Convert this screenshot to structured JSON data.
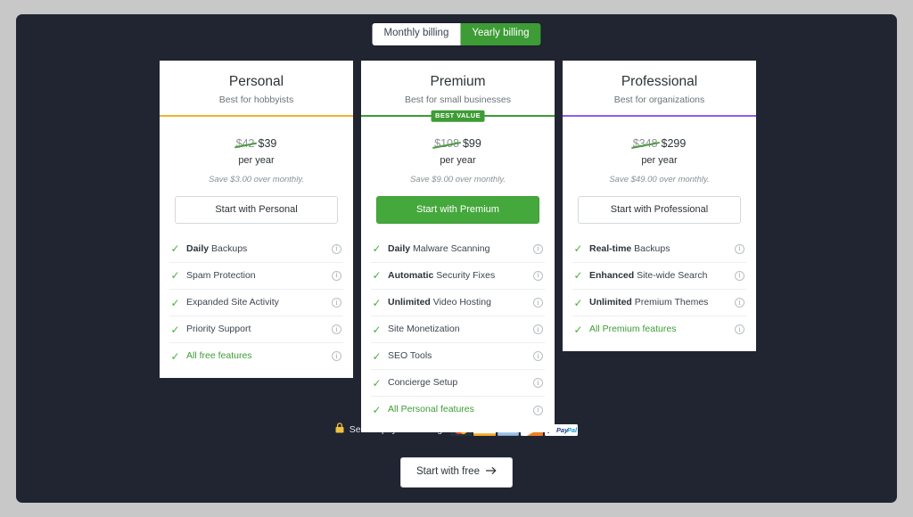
{
  "theme": {
    "page_background": "#c8c8c8",
    "viewport_background": "#212532",
    "card_background": "#ffffff",
    "green_accent": "#3d9c35",
    "amber_accent": "#f0b429",
    "purple_accent": "#8b5cf6"
  },
  "billing_toggle": {
    "monthly_label": "Monthly billing",
    "yearly_label": "Yearly billing",
    "selected": "Yearly billing"
  },
  "plans": [
    {
      "name": "Personal",
      "tagline": "Best for hobbyists",
      "accent_color": "#f0b429",
      "badge": null,
      "price_old": "$42",
      "price_new": "$39",
      "per_unit": "per year",
      "savings": "Save $3.00 over monthly.",
      "cta_label": "Start with Personal",
      "cta_style": "outline",
      "features": [
        {
          "bold": "Daily",
          "text": " Backups",
          "highlight": false,
          "info": "i"
        },
        {
          "bold": "",
          "text": "Spam Protection",
          "highlight": false,
          "info": "i"
        },
        {
          "bold": "",
          "text": "Expanded Site Activity",
          "highlight": false,
          "info": "i"
        },
        {
          "bold": "",
          "text": "Priority Support",
          "highlight": false,
          "info": "i"
        },
        {
          "bold": "",
          "text": "All free features",
          "highlight": true,
          "info": "i"
        }
      ]
    },
    {
      "name": "Premium",
      "tagline": "Best for small businesses",
      "accent_color": "#3d9c35",
      "badge": "BEST VALUE",
      "price_old": "$108",
      "price_new": "$99",
      "per_unit": "per year",
      "savings": "Save $9.00 over monthly.",
      "cta_label": "Start with Premium",
      "cta_style": "filled",
      "features": [
        {
          "bold": "Daily",
          "text": " Malware Scanning",
          "highlight": false,
          "info": "i"
        },
        {
          "bold": "Automatic",
          "text": " Security Fixes",
          "highlight": false,
          "info": "i"
        },
        {
          "bold": "Unlimited",
          "text": " Video Hosting",
          "highlight": false,
          "info": "i"
        },
        {
          "bold": "",
          "text": "Site Monetization",
          "highlight": false,
          "info": "i"
        },
        {
          "bold": "",
          "text": "SEO Tools",
          "highlight": false,
          "info": "i"
        },
        {
          "bold": "",
          "text": "Concierge Setup",
          "highlight": false,
          "info": "i"
        },
        {
          "bold": "",
          "text": "All Personal features",
          "highlight": true,
          "info": "i"
        }
      ]
    },
    {
      "name": "Professional",
      "tagline": "Best for organizations",
      "accent_color": "#8b5cf6",
      "badge": null,
      "price_old": "$348",
      "price_new": "$299",
      "per_unit": "per year",
      "savings": "Save $49.00 over monthly.",
      "cta_label": "Start with Professional",
      "cta_style": "outline",
      "features": [
        {
          "bold": "Real-time",
          "text": " Backups",
          "highlight": false,
          "info": "i"
        },
        {
          "bold": "Enhanced",
          "text": " Site-wide Search",
          "highlight": false,
          "info": "i"
        },
        {
          "bold": "Unlimited",
          "text": " Premium Themes",
          "highlight": false,
          "info": "i"
        },
        {
          "bold": "",
          "text": "All Premium features",
          "highlight": true,
          "info": "i"
        }
      ]
    }
  ],
  "secure_payment": {
    "lock_icon": "lock-icon",
    "label": "Secure payment using:",
    "methods": [
      {
        "name": "mastercard-logo",
        "label": "MasterCard"
      },
      {
        "name": "visa-logo",
        "label": "VISA"
      },
      {
        "name": "amex-logo",
        "label": "AMERICAN EXPRESS"
      },
      {
        "name": "discover-logo",
        "label": "DISCOVER"
      },
      {
        "name": "paypal-logo",
        "label": "PayPal"
      }
    ]
  },
  "free_cta": {
    "label": "Start with free",
    "arrow_icon": "arrow-right-icon"
  }
}
